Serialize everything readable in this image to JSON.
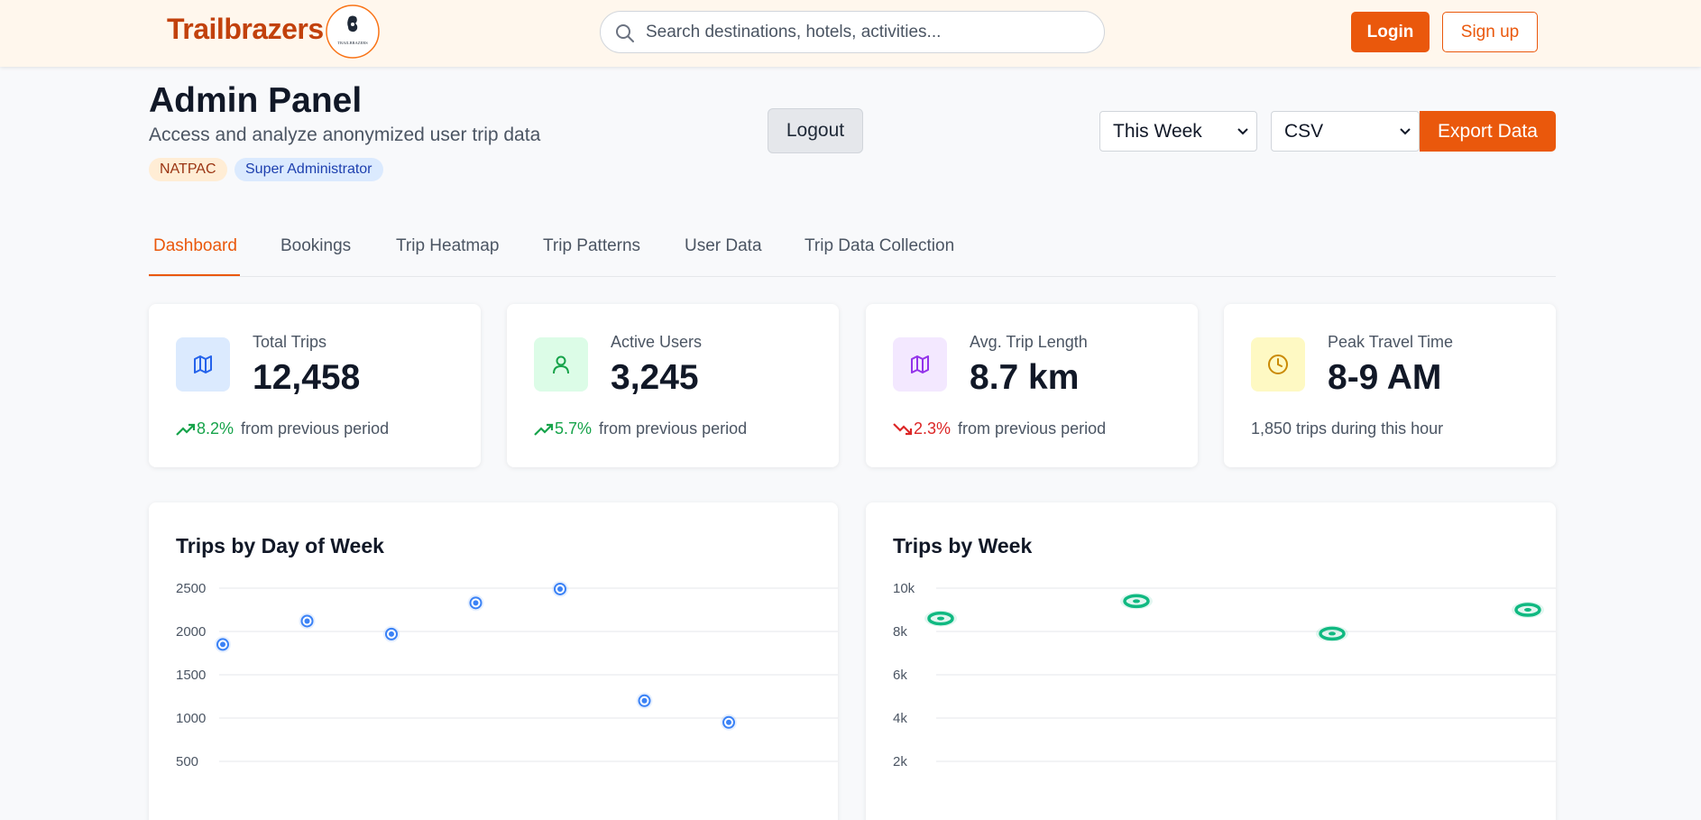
{
  "header": {
    "brand": "Trailbrazers",
    "logo_text": "TRAILBRAZERS",
    "search": {
      "placeholder": "Search destinations, hotels, activities..."
    },
    "login_label": "Login",
    "signup_label": "Sign up"
  },
  "admin": {
    "title": "Admin Panel",
    "subtitle": "Access and analyze anonymized user trip data",
    "badges": [
      "NATPAC",
      "Super Administrator"
    ],
    "logout_label": "Logout",
    "period_select": "This Week",
    "format_select": "CSV",
    "export_label": "Export Data"
  },
  "tabs": [
    {
      "label": "Dashboard",
      "active": true
    },
    {
      "label": "Bookings",
      "active": false
    },
    {
      "label": "Trip Heatmap",
      "active": false
    },
    {
      "label": "Trip Patterns",
      "active": false
    },
    {
      "label": "User Data",
      "active": false
    },
    {
      "label": "Trip Data Collection",
      "active": false
    }
  ],
  "stats": [
    {
      "label": "Total Trips",
      "value": "12,458",
      "change": "8.2%",
      "trend": "up",
      "footer": "from previous period",
      "icon": "map-icon",
      "icon_bg": "#dbeafe",
      "icon_color": "#2563eb"
    },
    {
      "label": "Active Users",
      "value": "3,245",
      "change": "5.7%",
      "trend": "up",
      "footer": "from previous period",
      "icon": "user-icon",
      "icon_bg": "#dcfce7",
      "icon_color": "#16a34a"
    },
    {
      "label": "Avg. Trip Length",
      "value": "8.7 km",
      "change": "2.3%",
      "trend": "down",
      "footer": "from previous period",
      "icon": "map-icon",
      "icon_bg": "#f3e8ff",
      "icon_color": "#9333ea"
    },
    {
      "label": "Peak Travel Time",
      "value": "8-9 AM",
      "change": "",
      "trend": "none",
      "footer": "1,850 trips during this hour",
      "icon": "clock-icon",
      "icon_bg": "#fef9c3",
      "icon_color": "#ca8a04"
    }
  ],
  "chart_data": [
    {
      "type": "scatter",
      "title": "Trips by Day of Week",
      "color": "#3b82f6",
      "ylim": [
        0,
        2500
      ],
      "yticks": [
        "2500",
        "2000",
        "1500",
        "1000",
        "500"
      ],
      "xlabel": "",
      "ylabel": "",
      "grid": true,
      "values": [
        1850,
        2120,
        1970,
        2330,
        2490,
        1200,
        950
      ]
    },
    {
      "type": "scatter",
      "title": "Trips by Week",
      "color": "#10b981",
      "ylim": [
        0,
        10000
      ],
      "yticks": [
        "10k",
        "8k",
        "6k",
        "4k",
        "2k"
      ],
      "xlabel": "",
      "ylabel": "",
      "grid": true,
      "values": [
        8600,
        9400,
        7900,
        9000
      ]
    }
  ]
}
